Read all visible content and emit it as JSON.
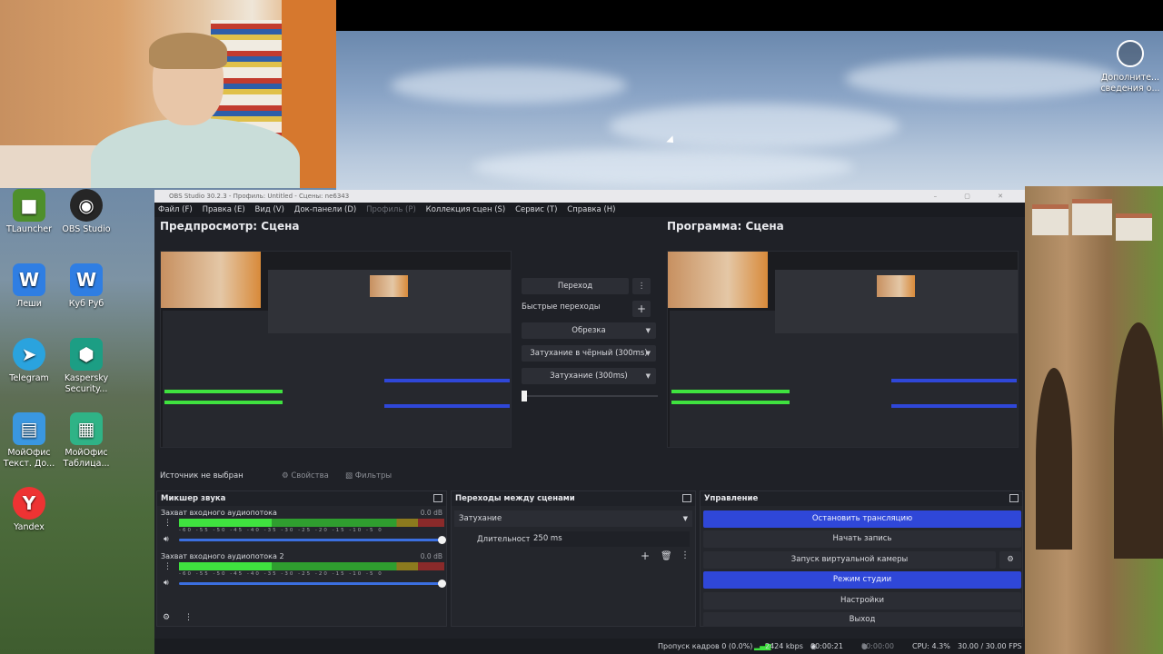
{
  "desktop": {
    "icons": [
      {
        "label": "TLauncher",
        "icon": "tlauncher-icon",
        "color": "#4e8f2b",
        "glyph": "■"
      },
      {
        "label": "OBS Studio",
        "icon": "obs-icon",
        "color": "#262626",
        "glyph": "◉"
      },
      {
        "label": "Леши",
        "icon": "word-doc-icon",
        "color": "#2f7ee3",
        "glyph": "W"
      },
      {
        "label": "Куб Руб",
        "icon": "word-doc-icon",
        "color": "#2f7ee3",
        "glyph": "W"
      },
      {
        "label": "Telegram",
        "icon": "telegram-icon",
        "color": "#2aa3de",
        "glyph": "➤"
      },
      {
        "label": "Kaspersky Security...",
        "icon": "kaspersky-icon",
        "color": "#1c9e84",
        "glyph": "⬢"
      },
      {
        "label": "МойОфис Текст. До...",
        "icon": "myoffice-text-icon",
        "color": "#3a97e0",
        "glyph": "▤"
      },
      {
        "label": "МойОфис Таблица...",
        "icon": "myoffice-table-icon",
        "color": "#2fb386",
        "glyph": "▦"
      },
      {
        "label": "Yandex",
        "icon": "yandex-icon",
        "color": "#e33",
        "glyph": "Y"
      }
    ],
    "notification": {
      "line1": "Дополните...",
      "line2": "сведения о..."
    }
  },
  "obs": {
    "title": "OBS Studio 30.2.3 - Профиль: Untitled - Сцены: ne6343",
    "menu": [
      {
        "label": "Файл (F)",
        "disabled": false
      },
      {
        "label": "Правка (E)",
        "disabled": false
      },
      {
        "label": "Вид (V)",
        "disabled": false
      },
      {
        "label": "Док-панели (D)",
        "disabled": false
      },
      {
        "label": "Профиль (P)",
        "disabled": true
      },
      {
        "label": "Коллекция сцен (S)",
        "disabled": false
      },
      {
        "label": "Сервис (T)",
        "disabled": false
      },
      {
        "label": "Справка (H)",
        "disabled": false
      }
    ],
    "preview_title": "Предпросмотр: Сцена",
    "program_title": "Программа: Сцена",
    "transition_panel": {
      "transition_button": "Переход",
      "quick_transitions": "Быстрые переходы",
      "items": [
        "Обрезка",
        "Затухание в чёрный (300ms)",
        "Затухание (300ms)"
      ]
    },
    "source_bar": {
      "status": "Источник не выбран",
      "properties": "Свойства",
      "filters": "Фильтры"
    },
    "mixer": {
      "title": "Микшер звука",
      "channels": [
        {
          "name": "Захват входного аудиопотока",
          "db": "0.0 dB",
          "level": 0.35
        },
        {
          "name": "Захват входного аудиопотока 2",
          "db": "0.0 dB",
          "level": 0.35
        }
      ],
      "scale": "-60 -55 -50 -45 -40 -35 -30 -25 -20 -15 -10 -5 0"
    },
    "scene_transitions": {
      "title": "Переходы между сценами",
      "selected": "Затухание",
      "duration_label": "Длительность",
      "duration_value": "250 ms"
    },
    "controls": {
      "title": "Управление",
      "buttons": [
        {
          "label": "Остановить трансляцию",
          "active": true
        },
        {
          "label": "Начать запись",
          "active": false
        },
        {
          "label": "Запуск виртуальной камеры",
          "active": false
        },
        {
          "label": "Режим студии",
          "active": true
        },
        {
          "label": "Настройки",
          "active": false
        },
        {
          "label": "Выход",
          "active": false
        }
      ]
    },
    "status": {
      "dropped_frames": "Пропуск кадров 0 (0.0%)",
      "bitrate": "2424 kbps",
      "stream_time": "00:00:21",
      "record_time": "00:00:00",
      "cpu": "CPU: 4.3%",
      "fps": "30.00 / 30.00 FPS"
    }
  }
}
